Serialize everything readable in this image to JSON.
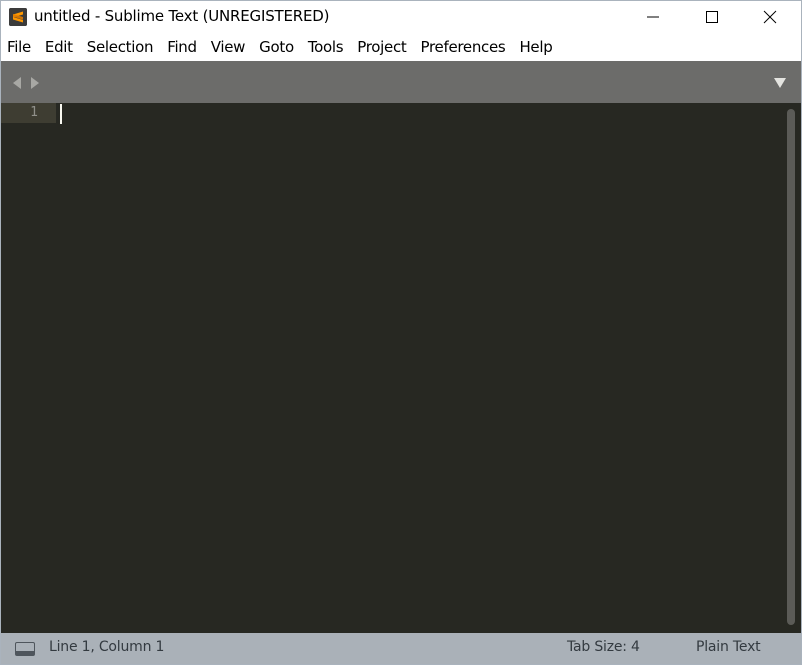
{
  "window": {
    "title": "untitled - Sublime Text (UNREGISTERED)",
    "app_icon": "sublime-text-logo",
    "controls": [
      "minimize-icon",
      "maximize-icon",
      "close-icon"
    ]
  },
  "menu": {
    "items": [
      {
        "label": "File"
      },
      {
        "label": "Edit"
      },
      {
        "label": "Selection"
      },
      {
        "label": "Find"
      },
      {
        "label": "View"
      },
      {
        "label": "Goto"
      },
      {
        "label": "Tools"
      },
      {
        "label": "Project"
      },
      {
        "label": "Preferences"
      },
      {
        "label": "Help"
      }
    ]
  },
  "tabbar": {
    "nav_icons": [
      "arrow-left-icon",
      "arrow-right-icon"
    ],
    "dropdown_icon": "triangle-down-icon"
  },
  "editor": {
    "lines": [
      {
        "number": "1",
        "text": ""
      }
    ],
    "current_line": 1
  },
  "status": {
    "panel_icon": "panel-toggle-icon",
    "position": "Line 1, Column 1",
    "tab_size": "Tab Size: 4",
    "syntax": "Plain Text"
  },
  "colors": {
    "editor_bg": "#272822",
    "gutter_highlight": "#3e3d32",
    "tabbar_bg": "#6c6c6a",
    "statusbar_bg": "#aab1b8",
    "caret": "#f8f8f0"
  }
}
